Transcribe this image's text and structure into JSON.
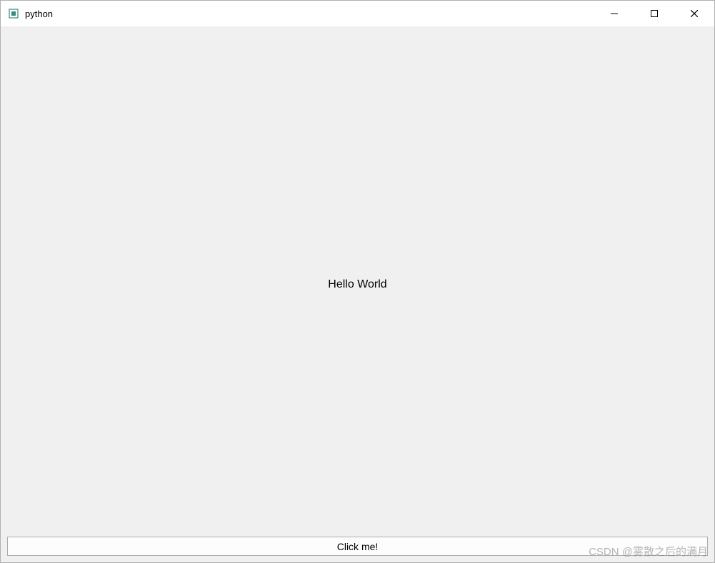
{
  "window": {
    "title": "python"
  },
  "content": {
    "label": "Hello World",
    "button_label": "Click me!"
  },
  "watermark": "CSDN @雾散之后的满月"
}
